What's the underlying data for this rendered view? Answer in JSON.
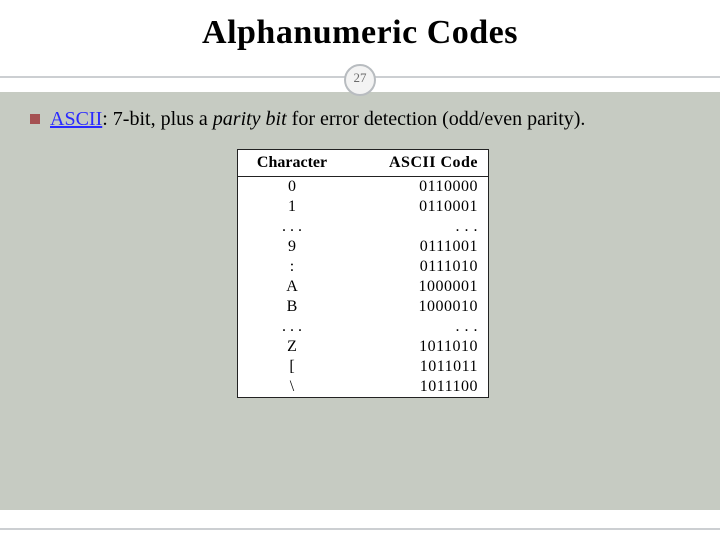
{
  "slide": {
    "title": "Alphanumeric Codes",
    "page_number": "27"
  },
  "bullet": {
    "link_text": "ASCII",
    "text_after_link": ": 7-bit, plus a ",
    "italic_text": "parity bit",
    "text_end": " for error detection (odd/even parity)."
  },
  "table": {
    "headers": {
      "col1": "Character",
      "col2": "ASCII Code"
    },
    "rows": [
      {
        "char": "0",
        "code": "0110000"
      },
      {
        "char": "1",
        "code": "0110001"
      },
      {
        "char": ". . .",
        "code": ". . ."
      },
      {
        "char": "9",
        "code": "0111001"
      },
      {
        "char": ":",
        "code": "0111010"
      },
      {
        "char": "A",
        "code": "1000001"
      },
      {
        "char": "B",
        "code": "1000010"
      },
      {
        "char": ". . .",
        "code": ". . ."
      },
      {
        "char": "Z",
        "code": "1011010"
      },
      {
        "char": "[",
        "code": "1011011"
      },
      {
        "char": "\\",
        "code": "1011100"
      }
    ]
  }
}
